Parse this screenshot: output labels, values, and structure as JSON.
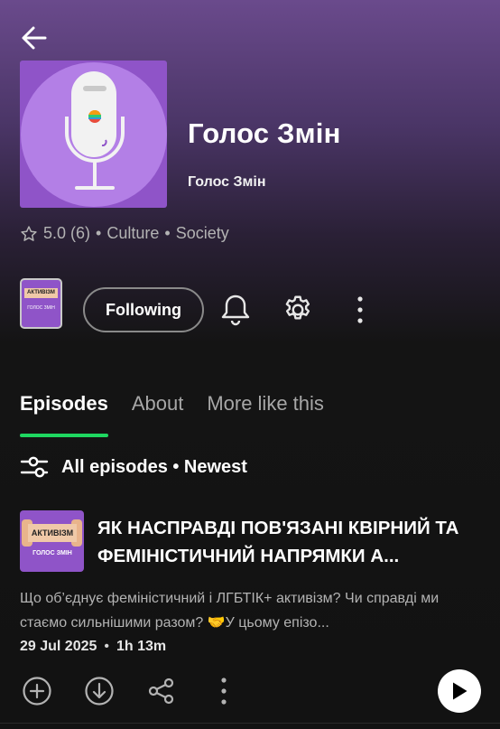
{
  "podcast": {
    "title": "Голос Змін",
    "author": "Голос Змін",
    "rating": "5.0 (6)",
    "categories": [
      "Culture",
      "Society"
    ],
    "follow_label": "Following",
    "cover_tag": "АКТИВІЗМ",
    "cover_sub": "ГОЛОС ЗМІН"
  },
  "tabs": [
    {
      "label": "Episodes",
      "active": true
    },
    {
      "label": "About",
      "active": false
    },
    {
      "label": "More like this",
      "active": false
    }
  ],
  "filter": {
    "label": "All episodes • Newest"
  },
  "episode": {
    "title": "ЯК НАСПРАВДІ ПОВ'ЯЗАНІ КВІРНИЙ ТА ФЕМІНІСТИЧНИЙ НАПРЯМКИ А...",
    "description": "Що об’єднує феміністичний і ЛГБТІК+ активізм? Чи справді ми стаємо сильнішими разом? 🤝У цьому епізо...",
    "date": "29 Jul 2025",
    "duration": "1h 13m",
    "cover_tag": "АКТИВІЗМ",
    "cover_sub": "ГОЛОС ЗМІН"
  },
  "icons": {
    "back": "arrow-left-icon",
    "rating": "star-icon",
    "bell": "bell-icon",
    "settings": "gear-icon",
    "more": "more-vertical-icon",
    "filter": "sliders-icon",
    "add": "plus-circle-icon",
    "download": "download-circle-icon",
    "share": "share-icon",
    "play": "play-icon"
  },
  "colors": {
    "accent": "#1ed760",
    "cover_purple": "#8f54c8",
    "header_gradient_top": "#6a4a8c",
    "background": "#121212"
  }
}
